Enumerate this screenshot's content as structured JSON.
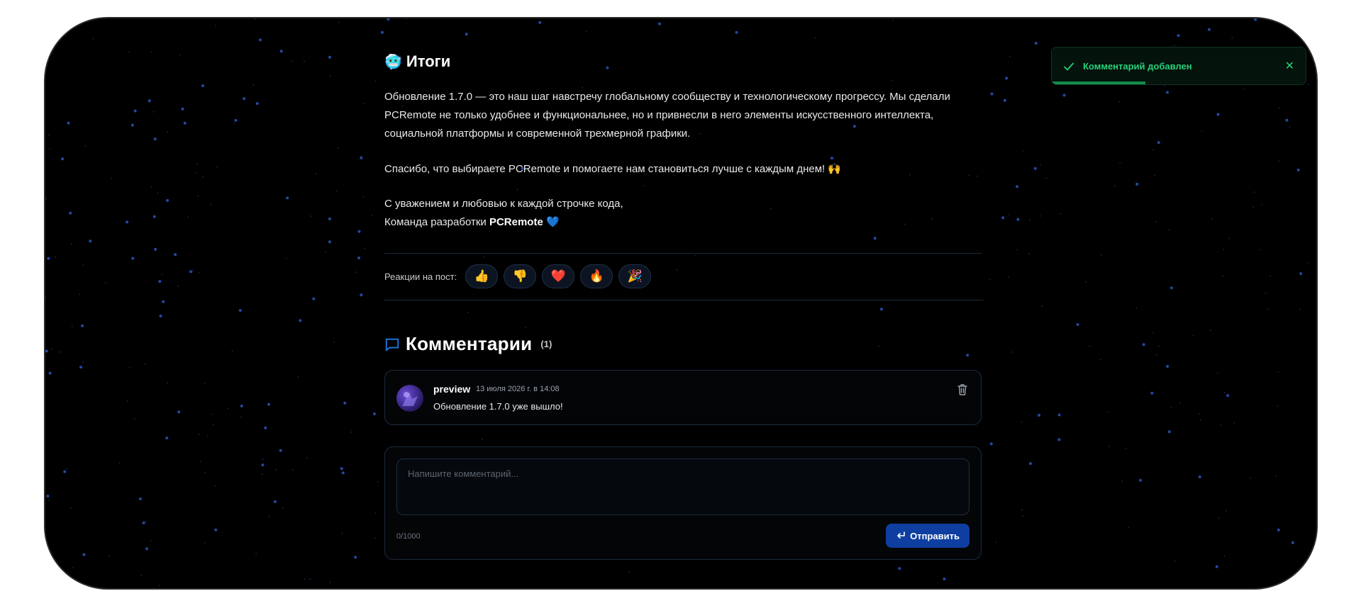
{
  "summary": {
    "emoji": "🥶",
    "heading": "Итоги",
    "paragraph": "Обновление 1.7.0 — это наш шаг навстречу глобальному сообществу и технологическому прогрессу. Мы сделали PCRemote не только удобнее и функциональнее, но и привнесли в него элементы искусственного интеллекта, социальной платформы и современной трехмерной графики.",
    "thanks": "Спасибо, что выбираете PCRemote и помогаете нам становиться лучше с каждым днем! 🙌",
    "signoff_line1": "С уважением и любовью к каждой строчке кода,",
    "signoff_prefix": "Команда разработки ",
    "signoff_brand": "PCRemote",
    "signoff_emoji": "💙"
  },
  "reactions": {
    "label": "Реакции на пост:",
    "items": [
      "👍",
      "👎",
      "❤️",
      "🔥",
      "🎉"
    ]
  },
  "comments": {
    "title": "Комментарии",
    "count": "(1)",
    "items": [
      {
        "author": "preview",
        "date": "13 июля 2026 г. в 14:08",
        "text": "Обновление 1.7.0 уже вышло!"
      }
    ]
  },
  "comment_form": {
    "placeholder": "Напишите комментарий...",
    "value": "",
    "counter": "0/1000",
    "submit_label": "Отправить"
  },
  "toast": {
    "message": "Комментарий добавлен",
    "progress": 0.37,
    "color": "#28d07a"
  },
  "colors": {
    "background": "#000000",
    "accent": "#0e3fa0",
    "success": "#28d07a",
    "dots": "#2f62d8"
  }
}
